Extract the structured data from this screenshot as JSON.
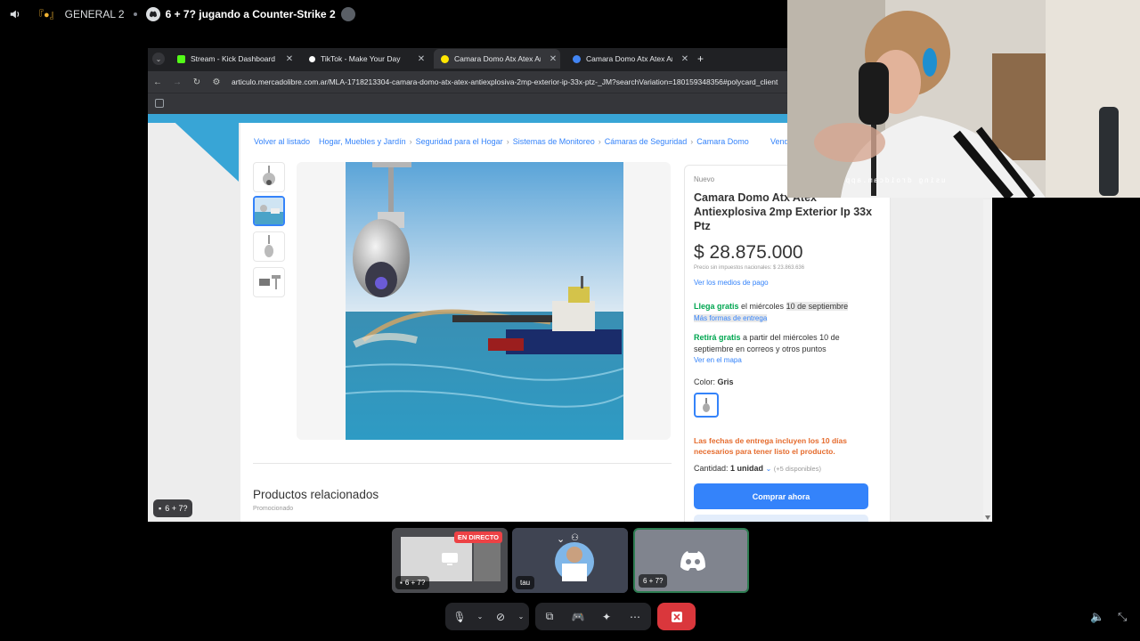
{
  "discord": {
    "server_name": "GENERAL 2",
    "call_title": "6 + 7? jugando a Counter-Strike 2"
  },
  "browser": {
    "tabs": [
      {
        "label": "Stream - Kick Dashboard",
        "favicon_color": "#53fc18",
        "active": false
      },
      {
        "label": "TikTok - Make Your Day",
        "favicon_color": "#ffffff",
        "active": false
      },
      {
        "label": "Camara Domo Atx Atex Antiexp",
        "favicon_color": "#ffe600",
        "active": true
      },
      {
        "label": "Camara Domo Atx Atex Antiexp",
        "favicon_color": "#4285f4",
        "active": false
      }
    ],
    "url": "articulo.mercadolibre.com.ar/MLA-1718213304-camara-domo-atx-atex-antiexplosiva-2mp-exterior-ip-33x-ptz-_JM?searchVariation=180159348356#polycard_client"
  },
  "page": {
    "breadcrumbs": [
      "Volver al listado",
      "Hogar, Muebles y Jardín",
      "Seguridad para el Hogar",
      "Sistemas de Monitoreo",
      "Cámaras de Seguridad",
      "Camara Domo"
    ],
    "breadcrumb_right": "Vend",
    "related_title": "Productos relacionados",
    "related_sub": "Promocionado",
    "product": {
      "condition": "Nuevo",
      "title": "Camara Domo Atx Atex Antiexplosiva 2mp Exterior Ip 33x Ptz",
      "price": "$ 28.875.000",
      "tax_note": "Precio sin impuestos nacionales: $ 23.863.636",
      "payment_link": "Ver los medios de pago",
      "shipping_free": "Llega gratis",
      "shipping_text": "el miércoles",
      "shipping_date": "10 de septiembre",
      "more_shipping": "Más formas de entrega",
      "pickup_free": "Retirá gratis",
      "pickup_text": "a partir del miércoles 10 de septiembre en correos y otros puntos",
      "map_link": "Ver en el mapa",
      "color_label": "Color:",
      "color_value": "Gris",
      "warning": "Las fechas de entrega incluyen los 10 días necesarios para tener listo el producto.",
      "qty_label": "Cantidad:",
      "qty_value": "1 unidad",
      "qty_available": "(+5 disponibles)",
      "buy_button": "Comprar ahora"
    }
  },
  "chat_badge": "6 + 7?",
  "webcam": {
    "watermark": "using droidcam.app"
  },
  "participants": [
    {
      "label": "6 + 7?",
      "live_badge": "EN DIRECTO"
    },
    {
      "label": "tau"
    },
    {
      "label": "6 + 7?"
    }
  ],
  "colors": {
    "ml_blue": "#3483fa",
    "ml_green": "#00a650",
    "ml_orange": "#e56b2d",
    "discord_red": "#da373c"
  }
}
